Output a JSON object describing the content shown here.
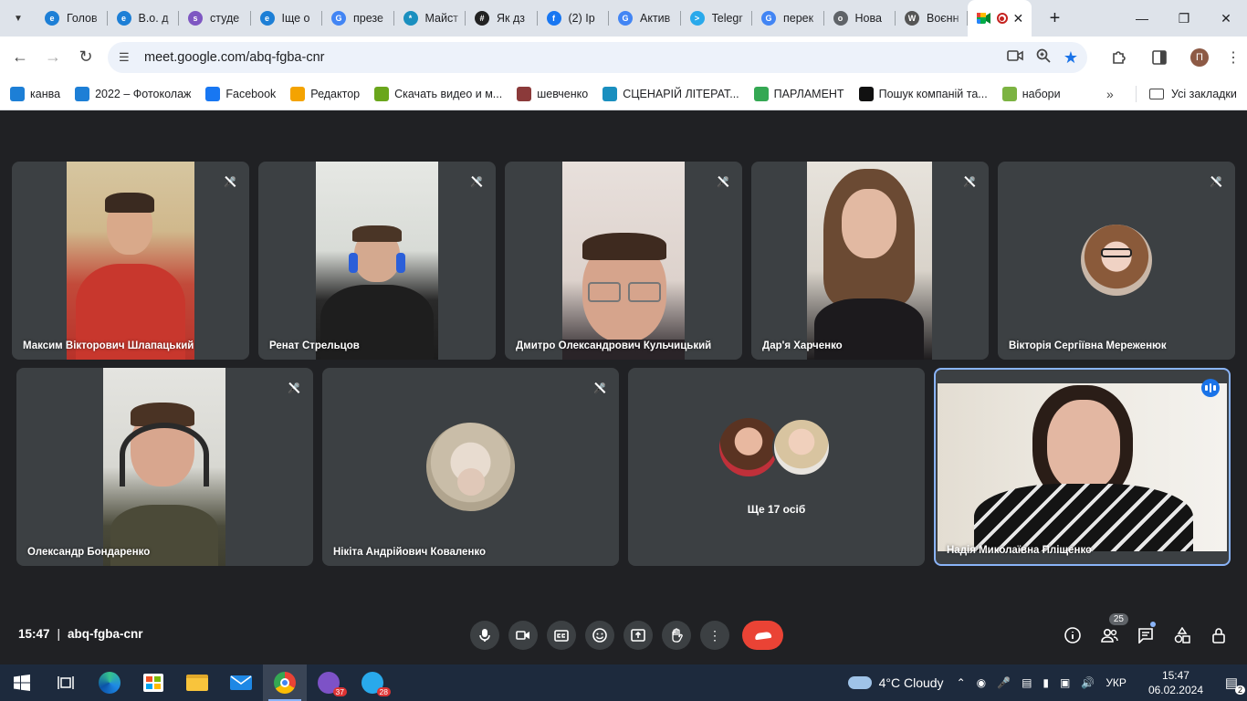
{
  "browser": {
    "tabs": [
      {
        "title": "Голов",
        "icon": "e",
        "color": "#1d7fd6"
      },
      {
        "title": "В.о. д",
        "icon": "e",
        "color": "#1d7fd6"
      },
      {
        "title": "студе",
        "icon": "s",
        "color": "#7e57c2"
      },
      {
        "title": "Іще о",
        "icon": "e",
        "color": "#1d7fd6"
      },
      {
        "title": "презе",
        "icon": "G",
        "color": "#4285f4"
      },
      {
        "title": "Майст",
        "icon": "*",
        "color": "#1a8fbf"
      },
      {
        "title": "Як дз",
        "icon": "#",
        "color": "#222"
      },
      {
        "title": "(2) Ір",
        "icon": "f",
        "color": "#1877f2"
      },
      {
        "title": "Актив",
        "icon": "G",
        "color": "#4285f4"
      },
      {
        "title": "Telegr",
        "icon": ">",
        "color": "#29a9eb"
      },
      {
        "title": "перек",
        "icon": "G",
        "color": "#4285f4"
      },
      {
        "title": "Нова",
        "icon": "o",
        "color": "#5f6368"
      },
      {
        "title": "Воєнн",
        "icon": "W",
        "color": "#555"
      }
    ],
    "address": "meet.google.com/abq-fgba-cnr",
    "bookmarks": [
      {
        "label": "канва",
        "color": "#1d7fd6"
      },
      {
        "label": "2022 – Фотоколаж",
        "color": "#1d7fd6"
      },
      {
        "label": "Facebook",
        "color": "#1877f2"
      },
      {
        "label": "Редактор",
        "color": "#f4a300"
      },
      {
        "label": "Скачать видео и м...",
        "color": "#6aa61c"
      },
      {
        "label": "шевченко",
        "color": "#8b3a3a"
      },
      {
        "label": "СЦЕНАРІЙ ЛІТЕРАТ...",
        "color": "#1a8fbf"
      },
      {
        "label": "ПАРЛАМЕНТ",
        "color": "#34a853"
      },
      {
        "label": "Пошук компаній та...",
        "color": "#111"
      },
      {
        "label": "набори",
        "color": "#7cb342"
      }
    ],
    "all_bookmarks": "Усі закладки",
    "profile_initial": "П"
  },
  "participants": [
    {
      "name": "Максим Вікторович Шлапацький"
    },
    {
      "name": "Ренат Стрельцов"
    },
    {
      "name": "Дмитро Олександрович Кульчицький"
    },
    {
      "name": "Дар'я Харченко"
    },
    {
      "name": "Вікторія Сергіївна Мереженюк"
    },
    {
      "name": "Олександр Бондаренко"
    },
    {
      "name": "Нікіта Андрійович Коваленко"
    },
    {
      "name": "Надія Миколаївна Пліщенко"
    }
  ],
  "more_tile": {
    "label": "Ще 17 осіб"
  },
  "meeting": {
    "time": "15:47",
    "separator": "|",
    "code": "abq-fgba-cnr"
  },
  "controls": {
    "people_count": "25"
  },
  "taskbar": {
    "viber_badge": "37",
    "telegram_badge": "28",
    "weather": "4°C  Cloudy",
    "language": "УКР",
    "clock_time": "15:47",
    "clock_date": "06.02.2024",
    "notifications": "2"
  }
}
